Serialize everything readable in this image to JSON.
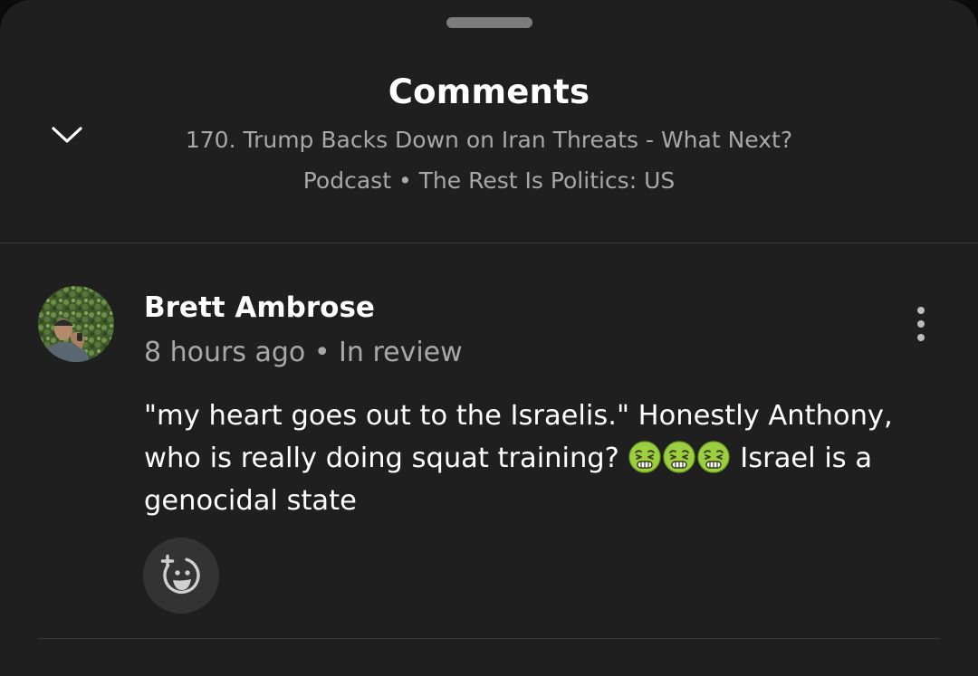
{
  "sheet": {
    "title": "Comments",
    "episode_title": "170. Trump Backs Down on Iran Threats - What Next?",
    "podcast_line": "Podcast • The Rest Is Politics: US",
    "collapse_icon": "chevron-down-icon"
  },
  "comment": {
    "author": "Brett Ambrose",
    "meta": "8 hours ago • In review",
    "text_part1": "\"my heart goes out to the Israelis.\" Honestly Anthony, who is really doing squat training?",
    "text_part2": "Israel is a genocidal state",
    "emoji_name": "nauseated-face-icon",
    "emoji_count": 3,
    "more_icon": "more-vertical-icon",
    "react_icon": "add-reaction-icon"
  },
  "colors": {
    "background": "#1f1f1f",
    "text_primary": "#ffffff",
    "text_secondary": "#a8a8a8",
    "emoji_face": "#9ccf3f"
  }
}
